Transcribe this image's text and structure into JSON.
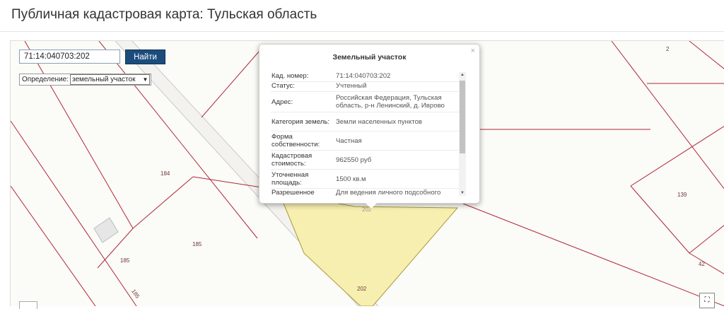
{
  "page": {
    "title": "Публичная кадастровая карта: Тульская область"
  },
  "search": {
    "value": "71:14:040703:202",
    "button_label": "Найти"
  },
  "definition": {
    "label": "Определение:",
    "selected": "земельный участок"
  },
  "map_labels": {
    "n2": "2",
    "n184": "184",
    "n139": "139",
    "n185a": "185",
    "n185b": "185",
    "n185c": "185",
    "n42": "42",
    "n202": "202",
    "n202top": "202"
  },
  "popup": {
    "title": "Земельный участок",
    "close": "×",
    "rows": [
      {
        "key": "Кад. номер:",
        "value": "71:14:040703:202"
      },
      {
        "key": "Статус:",
        "value": "Учтенный"
      },
      {
        "key": "Адрес:",
        "value": "Российская Федерация, Тульская область, р-н Ленинский, д. Иврово"
      },
      {
        "key": "Категория земель:",
        "value": "Земли населенных пунктов"
      },
      {
        "key": "Форма собственности:",
        "value": "Частная"
      },
      {
        "key": "Кадастровая стоимость:",
        "value": "962550 руб"
      },
      {
        "key": "Уточненная площадь:",
        "value": "1500 кв.м"
      },
      {
        "key": "Разрешенное",
        "value": "Для ведения личного подсобного"
      }
    ]
  },
  "colors": {
    "parcel_border": "#b0283a",
    "selected_fill": "#f7efb0",
    "button_bg": "#1c4c7c"
  },
  "icons": {
    "fullscreen": "fullscreen-icon"
  }
}
